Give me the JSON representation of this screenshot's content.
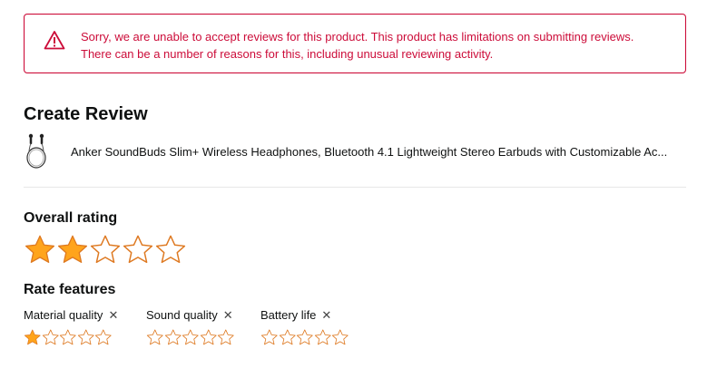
{
  "alert": {
    "icon": "warning-triangle-icon",
    "line1": "Sorry, we are unable to accept reviews for this product. This product has limitations on submitting reviews.",
    "line2": "There can be a number of reasons for this, including unusual reviewing activity.",
    "color": "#cc0c39"
  },
  "page": {
    "title": "Create Review"
  },
  "product": {
    "thumbnail": "earbuds-product-image",
    "title": "Anker SoundBuds Slim+ Wireless Headphones, Bluetooth 4.1 Lightweight Stereo Earbuds with Customizable Ac..."
  },
  "overall_rating": {
    "label": "Overall rating",
    "value": 2,
    "max": 5
  },
  "rate_features": {
    "label": "Rate features",
    "remove_glyph": "✕",
    "items": [
      {
        "name": "Material quality",
        "rating": 1,
        "max": 5
      },
      {
        "name": "Sound quality",
        "rating": 0,
        "max": 5
      },
      {
        "name": "Battery life",
        "rating": 0,
        "max": 5
      }
    ]
  },
  "colors": {
    "star_fill": "#ffa41c",
    "star_outline": "#de7921",
    "text": "#0f1111"
  }
}
